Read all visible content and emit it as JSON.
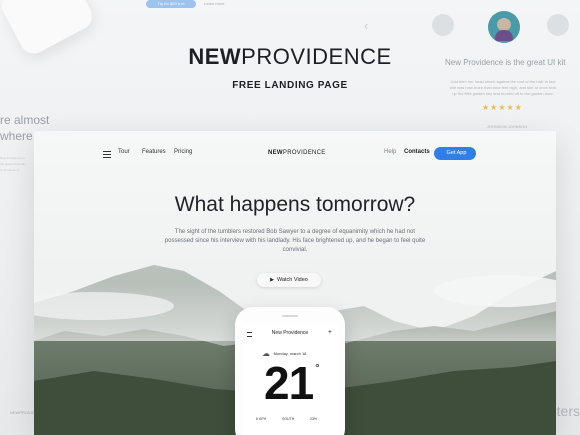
{
  "brand": {
    "bold": "NEW",
    "light": "PROVIDENCE"
  },
  "subtitle": "FREE LANDING PAGE",
  "background": {
    "pill": "Try for $20 a m",
    "link": "Learn more",
    "arrow": "‹",
    "tagline": "New Providence is the great UI kit",
    "quote": "Just then her head struck against the roof of the hall: in fact she was now more than nine feet high, and she at once took up the little golden key and hurried off to the garden door.",
    "stars": "★★★★★",
    "author": "JOHNSON JOHNSON",
    "left_text_1": "re almost",
    "left_text_2": "where",
    "left_small": "New Providence is the great UI kit fully of all elements",
    "right_text": "ters",
    "bottom_text": "NEWPROVIDENCE"
  },
  "nav": {
    "menu_icon": "hamburger-icon",
    "links": [
      "Tour",
      "Features",
      "Pricing"
    ],
    "logo_bold": "NEW",
    "logo_light": "PROVIDENCE",
    "help": "Help",
    "contacts": "Contacts",
    "cta": "Get App",
    "cta_icon": "apple-icon"
  },
  "hero": {
    "headline": "What happens tomorrow?",
    "paragraph": "The sight of the tumblers restored Bob Sawyer to a degree of equanimity which he had not possessed since his interview with his landlady. His face brightened up, and he began to feel quite convivial.",
    "watch_label": "Watch Video",
    "watch_icon": "play-icon"
  },
  "phone": {
    "title": "New Providence",
    "plus": "+",
    "date": "Monday, march 18",
    "weather_icon": "cloud-sun-icon",
    "temperature": "21",
    "degree": "°",
    "stats": [
      "6 KPH",
      "SOUTH",
      "23%"
    ]
  },
  "colors": {
    "accent": "#2f7fe6",
    "text": "#1c1f24",
    "muted": "#6b7178"
  }
}
